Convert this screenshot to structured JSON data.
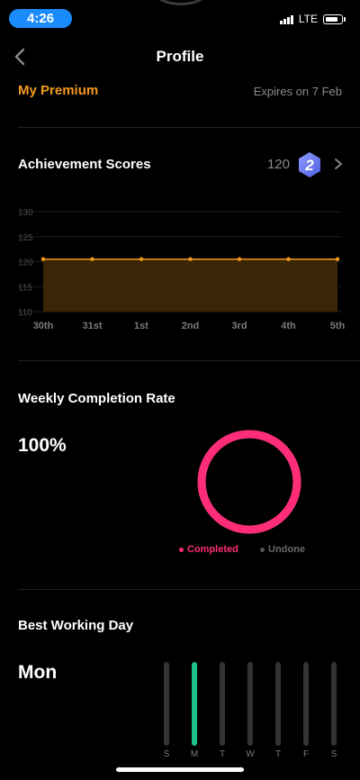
{
  "status": {
    "time": "4:26",
    "network": "LTE"
  },
  "nav": {
    "title": "Profile"
  },
  "premium": {
    "label": "My Premium",
    "expires": "Expires on 7 Feb"
  },
  "achievement": {
    "title": "Achievement Scores",
    "score": "120",
    "level": "2"
  },
  "chart_data": {
    "type": "area",
    "x": [
      "30th",
      "31st",
      "1st",
      "2nd",
      "3rd",
      "4th",
      "5th"
    ],
    "series": [
      {
        "values": [
          120.5,
          120.5,
          120.5,
          120.5,
          120.5,
          120.5,
          120.5
        ]
      }
    ],
    "y_ticks": [
      "110",
      "115",
      "120",
      "125",
      "130"
    ],
    "ylim": [
      110,
      130
    ],
    "grid": true,
    "colors": {
      "line": "#f39a1f",
      "fill": "#3a2506"
    }
  },
  "weekly": {
    "title": "Weekly Completion Rate",
    "rate": "100%",
    "completed_fraction": 1.0,
    "legend": [
      {
        "label": "Completed",
        "color": "#ff2d78"
      },
      {
        "label": "Undone",
        "color": "#555555"
      }
    ]
  },
  "best_day": {
    "title": "Best Working Day",
    "day": "Mon",
    "days": [
      "S",
      "M",
      "T",
      "W",
      "T",
      "F",
      "S"
    ],
    "active_index": 1
  },
  "colors": {
    "accent": "#f39a1f",
    "ring": "#ff2d78",
    "active_day": "#1ec28b",
    "status_pill": "#1a8cff"
  }
}
